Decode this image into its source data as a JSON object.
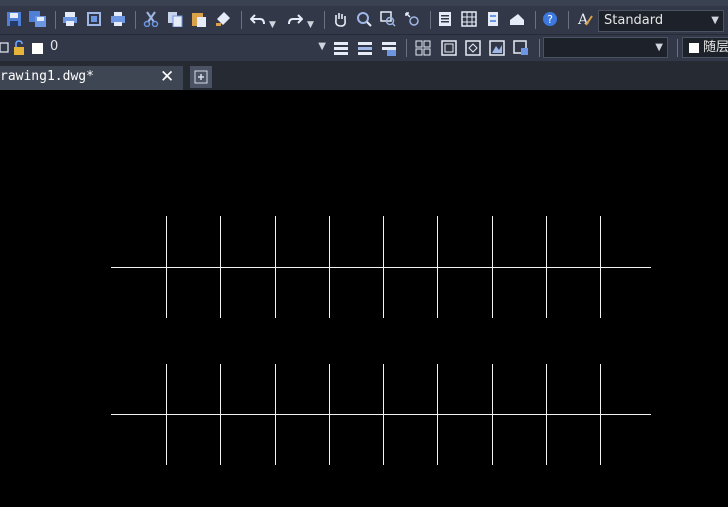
{
  "toolbar": {
    "icons": [
      "save-icon",
      "save-all-icon",
      "print-icon",
      "plot-preview-icon",
      "publish-icon",
      "cut-icon",
      "copy-icon",
      "paste-icon",
      "match-properties-icon",
      "undo-icon",
      "redo-icon",
      "pan-icon",
      "zoom-realtime-icon",
      "zoom-window-icon",
      "zoom-previous-icon",
      "properties-icon",
      "design-center-icon",
      "tool-palettes-icon",
      "sheet-set-icon",
      "help-icon",
      "text-style-icon"
    ],
    "text_style_value": "Standard"
  },
  "layer_bar": {
    "layer_value": "0",
    "linetype_value": "",
    "color_label": "随层"
  },
  "tabs": [
    {
      "label": "rawing1.dwg*"
    }
  ],
  "drawing": {
    "line_color": "#f2f2f2",
    "groups": [
      {
        "horizontal_count": 1,
        "vertical_count": 9
      },
      {
        "horizontal_count": 1,
        "vertical_count": 9
      }
    ]
  }
}
